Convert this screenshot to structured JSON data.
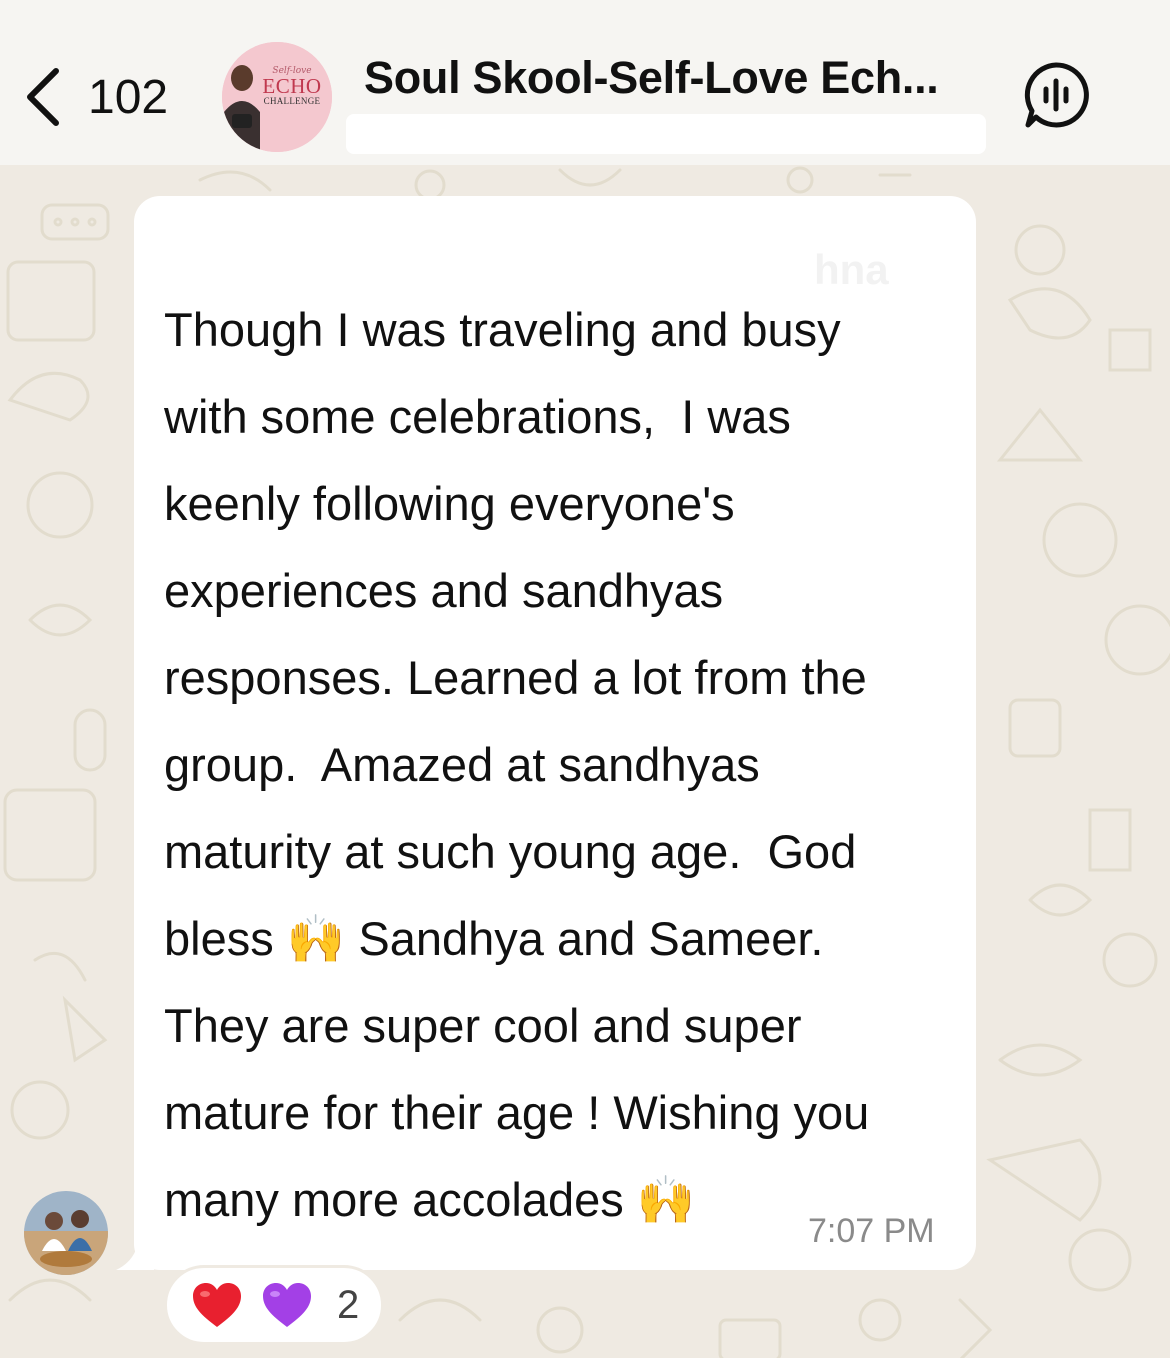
{
  "header": {
    "back_count": "102",
    "group_title": "Soul Skool-Self-Love Ech...",
    "avatar_badge": {
      "top_script": "Self-love",
      "word": "ECHO",
      "sub": "CHALLENGE"
    }
  },
  "message": {
    "text": "Though I was traveling and busy\nwith some celebrations,  I was\nkeenly following everyone's\nexperiences and sandhyas\nresponses. Learned a lot from the\ngroup.  Amazed at sandhyas\nmaturity at such young age.  God\nbless 🙌 Sandhya and Sameer.\nThey are super cool and super\nmature for their age ! Wishing you\nmany more accolades 🙌",
    "time": "7:07 PM",
    "sender_ghost": "hna"
  },
  "reactions": {
    "emojis": [
      "heart-red",
      "heart-purple"
    ],
    "count": "2"
  },
  "colors": {
    "wallpaper": "#efeae2",
    "doodle": "#e2dccd",
    "bubble": "#ffffff",
    "header": "#f6f5f2",
    "time": "#8a8a8a"
  },
  "icons": {
    "back": "chevron-left-icon",
    "voice_chat": "voice-chat-icon"
  }
}
